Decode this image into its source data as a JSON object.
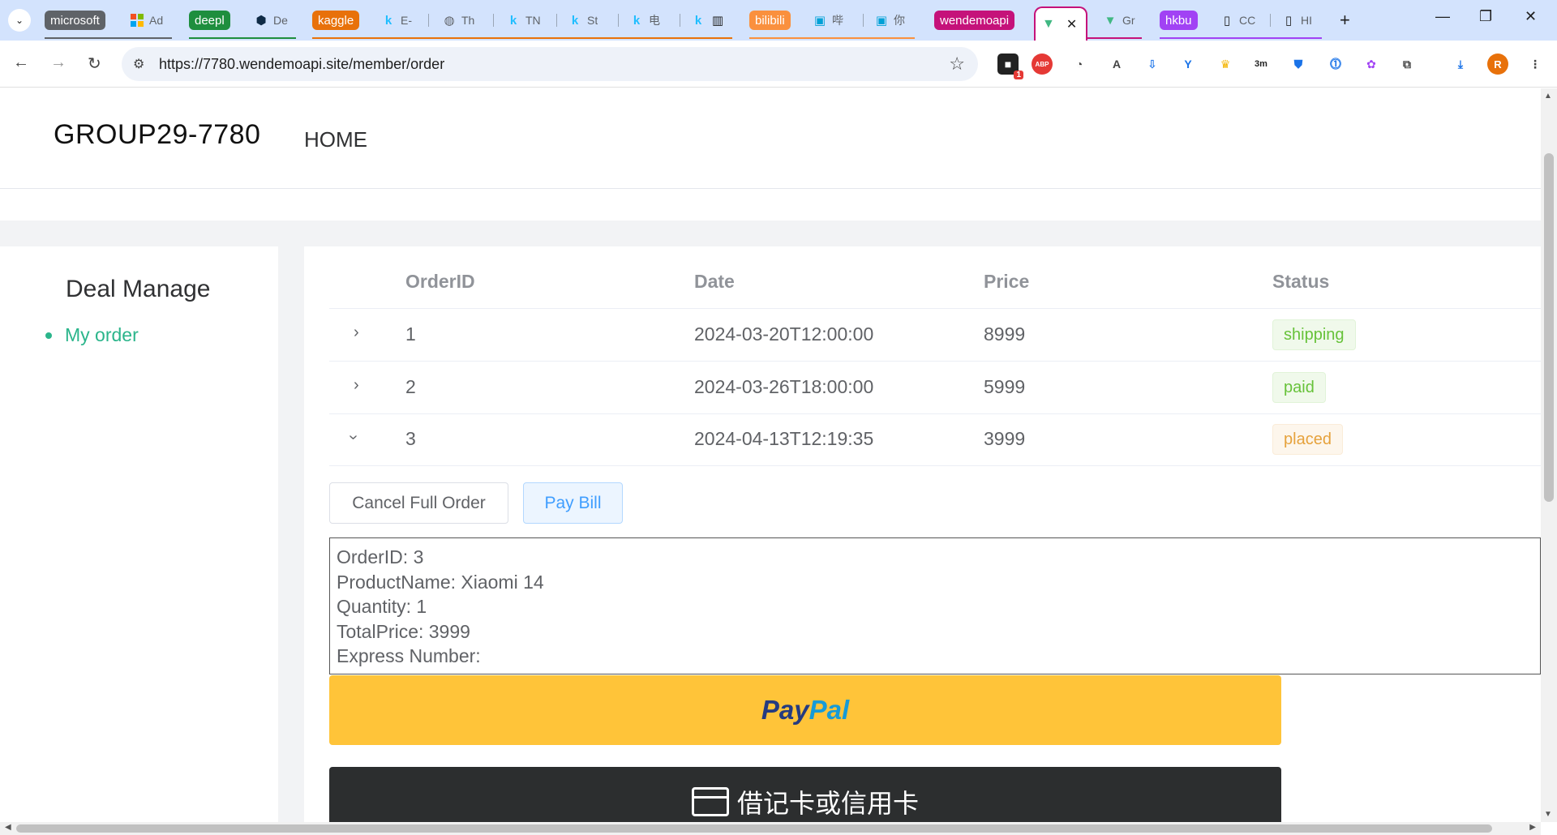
{
  "browser": {
    "tabs": [
      {
        "group": "microsoft",
        "group_color": "#5f6368",
        "title": "Ad",
        "icon": "microsoft-icon"
      },
      {
        "group": "deepl",
        "group_color": "#1e8e3e",
        "title": "De",
        "icon": "deepl-icon"
      },
      {
        "group": "kaggle",
        "group_color": "#e8710a",
        "title": "E-",
        "icon": "kaggle-icon"
      },
      {
        "title": "Th",
        "icon": "globe-icon"
      },
      {
        "title": "TN",
        "icon": "kaggle-icon"
      },
      {
        "title": "St",
        "icon": "kaggle-icon"
      },
      {
        "title": "电",
        "icon": "kaggle-icon"
      },
      {
        "title": "",
        "icon": "chart-icon"
      },
      {
        "group": "bilibili",
        "group_color": "#fa903e",
        "title": "哔",
        "icon": "bilibili-icon"
      },
      {
        "title": "你",
        "icon": "bilibili-icon"
      },
      {
        "group": "wendemoapi",
        "group_color": "#c5127a",
        "title": "",
        "icon": "vue-icon",
        "active": true
      },
      {
        "title": "Gr",
        "icon": "vue-icon"
      },
      {
        "group": "hkbu",
        "group_color": "#a142f4",
        "title": "CC",
        "icon": "book-icon"
      },
      {
        "title": "HI",
        "icon": "book-icon"
      }
    ],
    "url": "https://7780.wendemoapi.site/member/order",
    "ext_badge": "1",
    "ext_abp": "ABP",
    "ext_timer": "3m",
    "profile_initial": "R"
  },
  "site": {
    "logo": "GROUP29-7780",
    "nav_home": "HOME"
  },
  "aside": {
    "title": "Deal Manage",
    "items": [
      {
        "label": "My order",
        "active": true,
        "color": "#2bb58b"
      }
    ]
  },
  "orders": {
    "columns": [
      "OrderID",
      "Date",
      "Price",
      "Status"
    ],
    "rows": [
      {
        "id": "1",
        "date": "2024-03-20T12:00:00",
        "price": "8999",
        "status": "shipping",
        "status_color": "#67c23a",
        "expanded": false
      },
      {
        "id": "2",
        "date": "2024-03-26T18:00:00",
        "price": "5999",
        "status": "paid",
        "status_color": "#67c23a",
        "expanded": false
      },
      {
        "id": "3",
        "date": "2024-04-13T12:19:35",
        "price": "3999",
        "status": "placed",
        "status_color": "#e6a23c",
        "expanded": true
      }
    ],
    "actions": {
      "cancel": "Cancel Full Order",
      "pay": "Pay Bill"
    },
    "detail": [
      "OrderID: 3",
      "ProductName: Xiaomi 14",
      "Quantity: 1",
      "TotalPrice: 3999",
      "Express Number:"
    ]
  },
  "payment": {
    "paypal_part1": "Pay",
    "paypal_part2": "Pal",
    "card_label": "借记卡或信用卡"
  }
}
